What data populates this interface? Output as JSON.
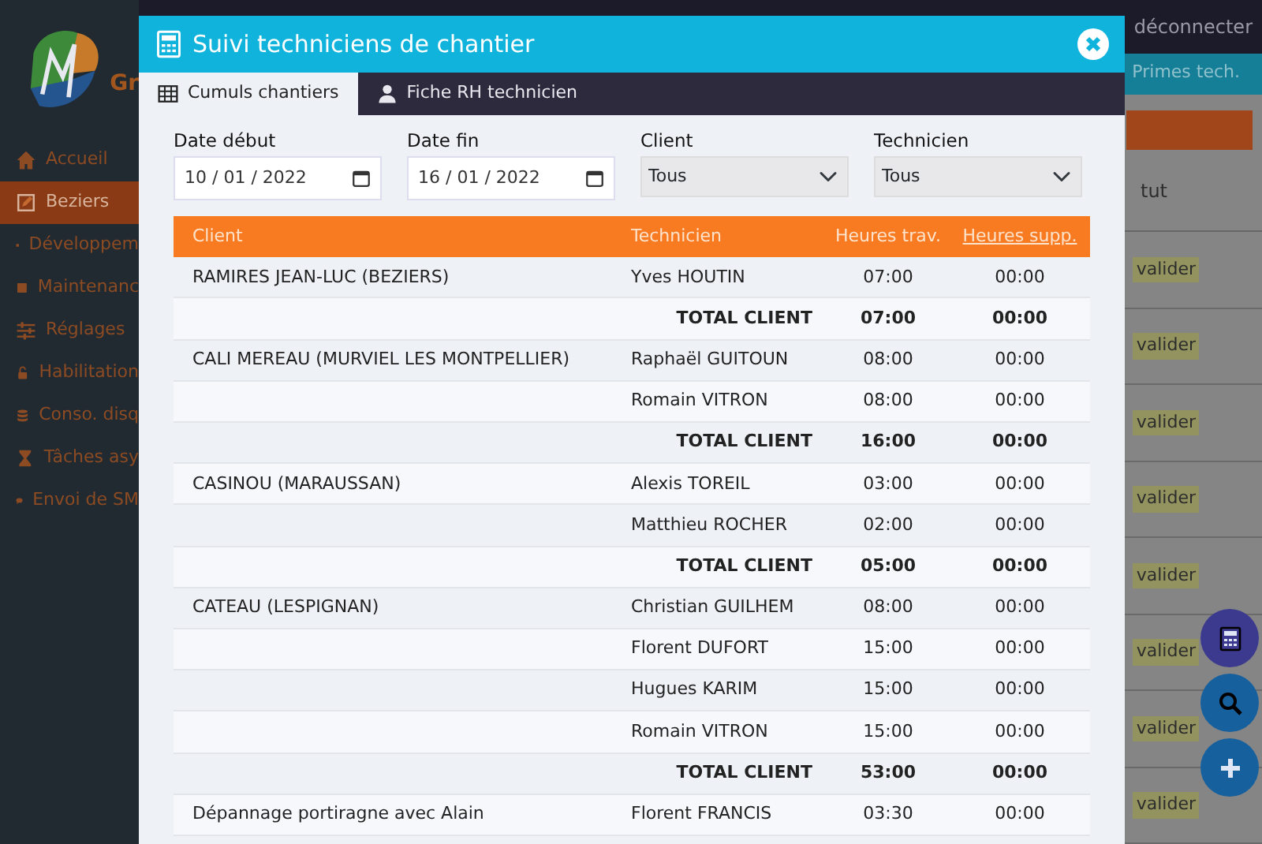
{
  "app": {
    "logo_text": "Gr",
    "sidebar": {
      "items": [
        {
          "label": "Accueil",
          "selected": false
        },
        {
          "label": "Beziers",
          "selected": true
        },
        {
          "label": "Développem",
          "selected": false
        },
        {
          "label": "Maintenanc",
          "selected": false
        },
        {
          "label": "Réglages",
          "selected": false
        },
        {
          "label": "Habilitation",
          "selected": false
        },
        {
          "label": "Conso. disq",
          "selected": false
        },
        {
          "label": "Tâches asy",
          "selected": false
        },
        {
          "label": "Envoi de SM",
          "selected": false
        }
      ]
    },
    "top_link": "déconnecter",
    "nav_tab": "Primes tech.",
    "column_header": "tut",
    "row_labels": [
      "valider",
      "valider",
      "valider",
      "valider",
      "valider",
      "valider",
      "valider",
      "valider"
    ],
    "floating_buttons": [
      {
        "color": "#3b3a8e"
      },
      {
        "color": "#17609e"
      },
      {
        "color": "#17609e"
      }
    ]
  },
  "modal": {
    "title": "Suivi techniciens de chantier",
    "tabs": [
      {
        "label": "Cumuls chantiers",
        "selected": true
      },
      {
        "label": "Fiche RH technicien",
        "selected": false
      }
    ],
    "filters": [
      {
        "kind": "date",
        "label": "Date début",
        "value": "10 / 01 / 2022"
      },
      {
        "kind": "date",
        "label": "Date fin",
        "value": "16 / 01 / 2022"
      },
      {
        "kind": "select",
        "label": "Client",
        "value": "Tous"
      },
      {
        "kind": "select",
        "label": "Technicien",
        "value": "Tous"
      }
    ],
    "table": {
      "columns": [
        "Client",
        "Technicien",
        "Heures trav.",
        "Heures supp."
      ],
      "rows": [
        {
          "kind": "entry",
          "client": "RAMIRES JEAN-LUC (BEZIERS)",
          "technician": "Yves HOUTIN",
          "hours": "07:00",
          "overtime": "00:00"
        },
        {
          "kind": "total",
          "label": "TOTAL CLIENT",
          "hours": "07:00",
          "overtime": "00:00"
        },
        {
          "kind": "entry",
          "client": "CALI MEREAU (MURVIEL LES MONTPELLIER)",
          "technician": "Raphaël GUITOUN",
          "hours": "08:00",
          "overtime": "00:00"
        },
        {
          "kind": "entry",
          "technician": "Romain VITRON",
          "hours": "08:00",
          "overtime": "00:00"
        },
        {
          "kind": "total",
          "label": "TOTAL CLIENT",
          "hours": "16:00",
          "overtime": "00:00"
        },
        {
          "kind": "entry",
          "client": "CASINOU (MARAUSSAN)",
          "technician": "Alexis TOREIL",
          "hours": "03:00",
          "overtime": "00:00"
        },
        {
          "kind": "entry",
          "technician": "Matthieu ROCHER",
          "hours": "02:00",
          "overtime": "00:00"
        },
        {
          "kind": "total",
          "label": "TOTAL CLIENT",
          "hours": "05:00",
          "overtime": "00:00"
        },
        {
          "kind": "entry",
          "client": "CATEAU (LESPIGNAN)",
          "technician": "Christian GUILHEM",
          "hours": "08:00",
          "overtime": "00:00"
        },
        {
          "kind": "entry",
          "technician": "Florent DUFORT",
          "hours": "15:00",
          "overtime": "00:00"
        },
        {
          "kind": "entry",
          "technician": "Hugues KARIM",
          "hours": "15:00",
          "overtime": "00:00"
        },
        {
          "kind": "entry",
          "technician": "Romain VITRON",
          "hours": "15:00",
          "overtime": "00:00"
        },
        {
          "kind": "total",
          "label": "TOTAL CLIENT",
          "hours": "53:00",
          "overtime": "00:00"
        },
        {
          "kind": "entry",
          "client": "Dépannage portiragne avec Alain",
          "technician": "Florent FRANCIS",
          "hours": "03:30",
          "overtime": "00:00"
        }
      ]
    }
  }
}
